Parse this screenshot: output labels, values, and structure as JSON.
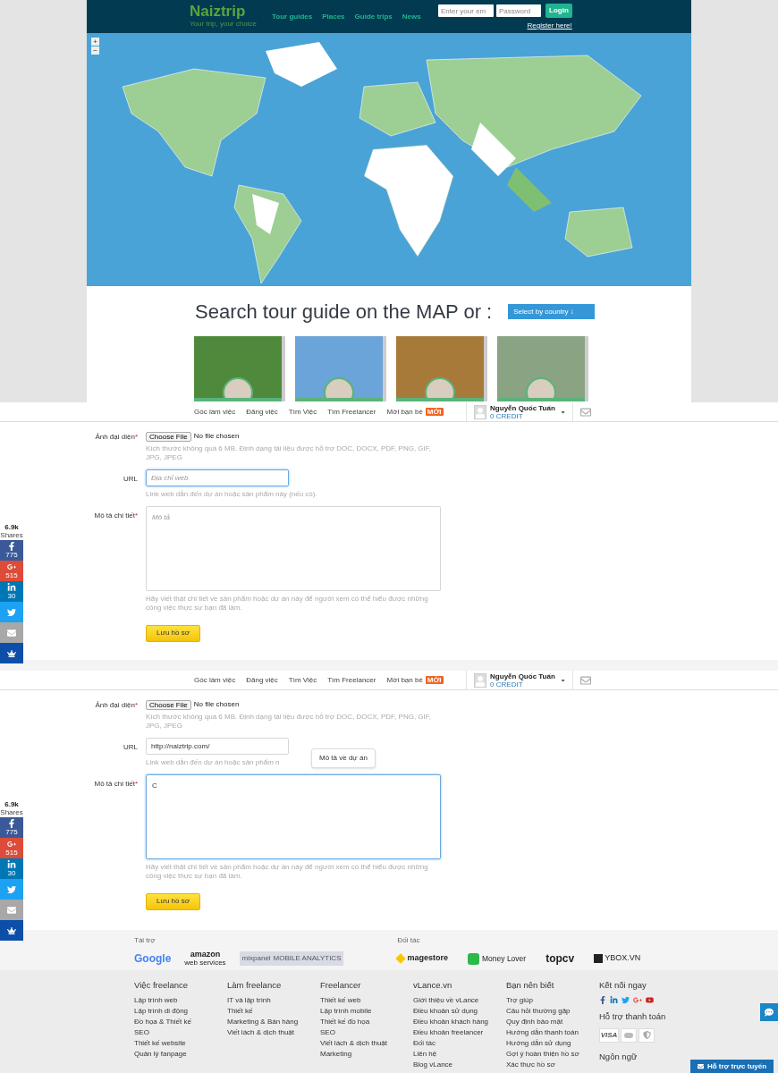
{
  "header": {
    "logo": "Naiztrip",
    "tagline": "Your trip, your choice",
    "nav": [
      {
        "label": "Tour guides"
      },
      {
        "label": "Places"
      },
      {
        "label": "Guide trips"
      },
      {
        "label": "News"
      }
    ],
    "email_placeholder": "Enter your em",
    "password_placeholder": "Password",
    "login": "Login",
    "register": "Register here!"
  },
  "map": {
    "zoom_in": "+",
    "zoom_out": "−"
  },
  "search": {
    "title": "Search tour guide on the MAP or :",
    "select": "Select by country ↓"
  },
  "panels": [
    {
      "nav": [
        {
          "label": "Góc làm việc"
        },
        {
          "label": "Đăng việc"
        },
        {
          "label": "Tìm Việc"
        },
        {
          "label": "Tìm Freelancer"
        },
        {
          "label": "Mời bạn bè",
          "badge": "MỚI"
        }
      ],
      "user": {
        "name": "Nguyễn Quốc Tuấn",
        "credit": "0 CREDIT"
      },
      "avatar_field": {
        "label": "Ảnh đại diện",
        "required_mark": "*",
        "button": "Choose File",
        "status": "No file chosen",
        "hint": "Kích thước không quá 6 MB. Định dạng tài liệu được hỗ trợ DOC, DOCX, PDF, PNG, GIF, JPG, JPEG"
      },
      "url_field": {
        "label": "URL",
        "placeholder": "Địa chỉ web",
        "focused": true,
        "hint": "Link web dẫn đến dự án hoặc sản phẩm này (nếu có)."
      },
      "description_field": {
        "label": "Mô tả chi tiết",
        "required_mark": "*",
        "placeholder": "Mô tả",
        "focused": false,
        "hint": "Hãy viết thật chi tiết về sản phẩm hoặc dự án này để người xem có thể hiểu được những công việc thực sự bạn đã làm."
      },
      "save": "Lưu hồ sơ",
      "share": {
        "total": "6.9k",
        "label": "Shares",
        "buttons": [
          {
            "kind": "facebook",
            "count": "775"
          },
          {
            "kind": "google",
            "count": "515"
          },
          {
            "kind": "linkedin",
            "count": "30"
          },
          {
            "kind": "twitter"
          },
          {
            "kind": "email"
          },
          {
            "kind": "crown"
          }
        ]
      }
    },
    {
      "nav": [
        {
          "label": "Góc làm việc"
        },
        {
          "label": "Đăng việc"
        },
        {
          "label": "Tìm Việc"
        },
        {
          "label": "Tìm Freelancer"
        },
        {
          "label": "Mời bạn bè",
          "badge": "MỚI"
        }
      ],
      "user": {
        "name": "Nguyễn Quốc Tuấn",
        "credit": "0 CREDIT"
      },
      "avatar_field": {
        "label": "Ảnh đại diện",
        "required_mark": "*",
        "button": "Choose File",
        "status": "No file chosen",
        "hint": "Kích thước không quá 6 MB. Định dạng tài liệu được hỗ trợ DOC, DOCX, PDF, PNG, GIF, JPG, JPEG"
      },
      "url_field": {
        "label": "URL",
        "value": "http://naiztrip.com/",
        "focused": false,
        "hint": "Link web dẫn đến dự án hoặc sản phẩm n"
      },
      "tooltip": "Mô tả về dự án",
      "description_field": {
        "label": "Mô tả chi tiết",
        "required_mark": "*",
        "value": "C",
        "focused": true,
        "hint": "Hãy viết thật chi tiết về sản phẩm hoặc dự án này để người xem có thể hiểu được những công việc thực sự bạn đã làm."
      },
      "save": "Lưu hồ sơ",
      "share": {
        "total": "6.9k",
        "label": "Shares",
        "buttons": [
          {
            "kind": "facebook",
            "count": "775"
          },
          {
            "kind": "google",
            "count": "515"
          },
          {
            "kind": "linkedin",
            "count": "30"
          },
          {
            "kind": "twitter"
          },
          {
            "kind": "email"
          },
          {
            "kind": "crown"
          }
        ]
      }
    }
  ],
  "sponsors": {
    "label": "Tài trợ",
    "logos": [
      {
        "kind": "google",
        "text": "Google"
      },
      {
        "kind": "amazon",
        "text": "amazon",
        "sub": "web services"
      },
      {
        "kind": "mixpanel",
        "text": "mixpanel",
        "sub": "MOBILE ANALYTICS"
      }
    ]
  },
  "partners": {
    "label": "Đối tác",
    "logos": [
      {
        "kind": "magestore",
        "text": "magestore"
      },
      {
        "kind": "moneylover",
        "text": "Money Lover"
      },
      {
        "kind": "topcv",
        "text": "topcv"
      },
      {
        "kind": "ybox",
        "text": "YBOX.VN"
      }
    ]
  },
  "footer": {
    "columns": [
      {
        "title": "Việc freelance",
        "links": [
          "Lập trình web",
          "Lập trình di động",
          "Đồ họa & Thiết kế",
          "SEO",
          "Thiết kế website",
          "Quản lý fanpage"
        ]
      },
      {
        "title": "Làm freelance",
        "links": [
          "IT và lập trình",
          "Thiết kế",
          "Marketing & Bán hàng",
          "Viết lách & dịch thuật"
        ]
      },
      {
        "title": "Freelancer",
        "links": [
          "Thiết kế web",
          "Lập trình mobile",
          "Thiết kế đồ họa",
          "SEO",
          "Viết lách & dịch thuật",
          "Marketing"
        ]
      },
      {
        "title": "vLance.vn",
        "links": [
          "Giới thiệu về vLance",
          "Điều khoản sử dụng",
          "Điều khoản khách hàng",
          "Điều khoản freelancer",
          "Đối tác",
          "Liên hệ",
          "Blog vLance"
        ]
      },
      {
        "title": "Bạn nên biết",
        "links": [
          "Trợ giúp",
          "Câu hỏi thường gặp",
          "Quy định bảo mật",
          "Hướng dẫn thanh toán",
          "Hướng dẫn sử dụng",
          "Gợi ý hoàn thiện hồ sơ",
          "Xác thực hồ sơ"
        ]
      }
    ],
    "connect_title": "Kết nối ngay",
    "payment_title": "Hỗ trợ thanh toán",
    "payment_visa": "VISA",
    "language_title": "Ngôn ngữ"
  },
  "chat_button": "Hỗ trợ trực tuyến"
}
